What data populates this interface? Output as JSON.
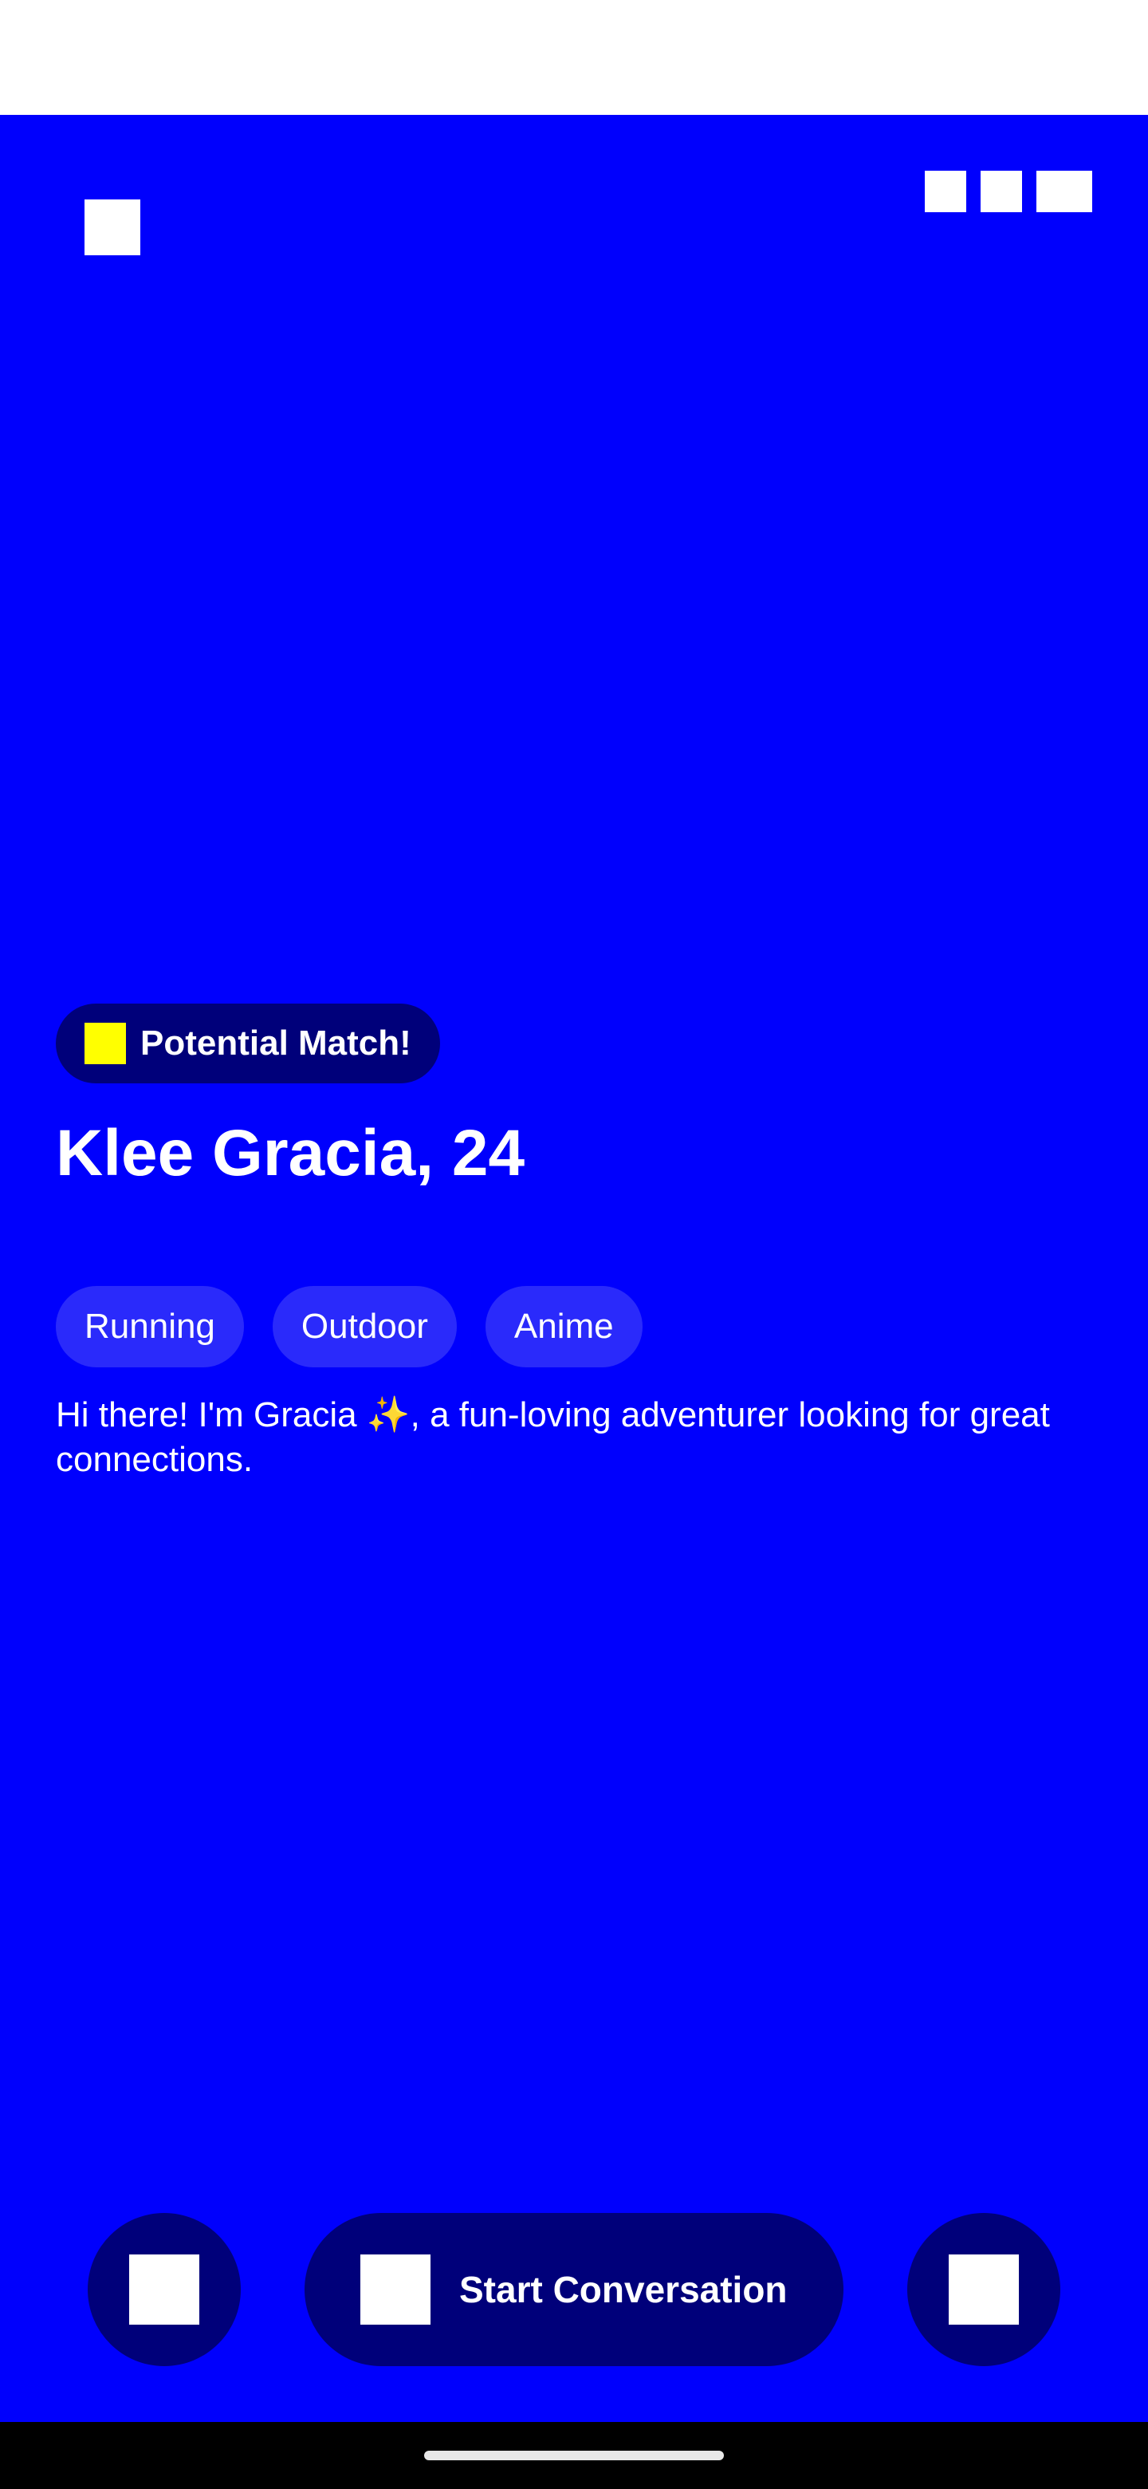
{
  "profile": {
    "badge_label": "Potential Match!",
    "name_age": "Klee Gracia, 24",
    "tags": [
      "Running",
      "Outdoor",
      "Anime"
    ],
    "bio": "Hi there! I'm Gracia ✨, a fun-loving adventurer looking for great connections."
  },
  "actions": {
    "start_label": "Start Conversation"
  },
  "icons": {
    "back": "back-icon",
    "top_1": "action-icon",
    "top_2": "action-icon",
    "top_3": "action-icon",
    "badge": "star-icon",
    "left_action": "close-icon",
    "start": "chat-icon",
    "right_action": "like-icon"
  },
  "colors": {
    "background": "#0000fd",
    "button_dark": "#00007a",
    "tag_bg": "#2a2afb",
    "badge_icon": "#ffff00",
    "text": "#ffffff"
  }
}
